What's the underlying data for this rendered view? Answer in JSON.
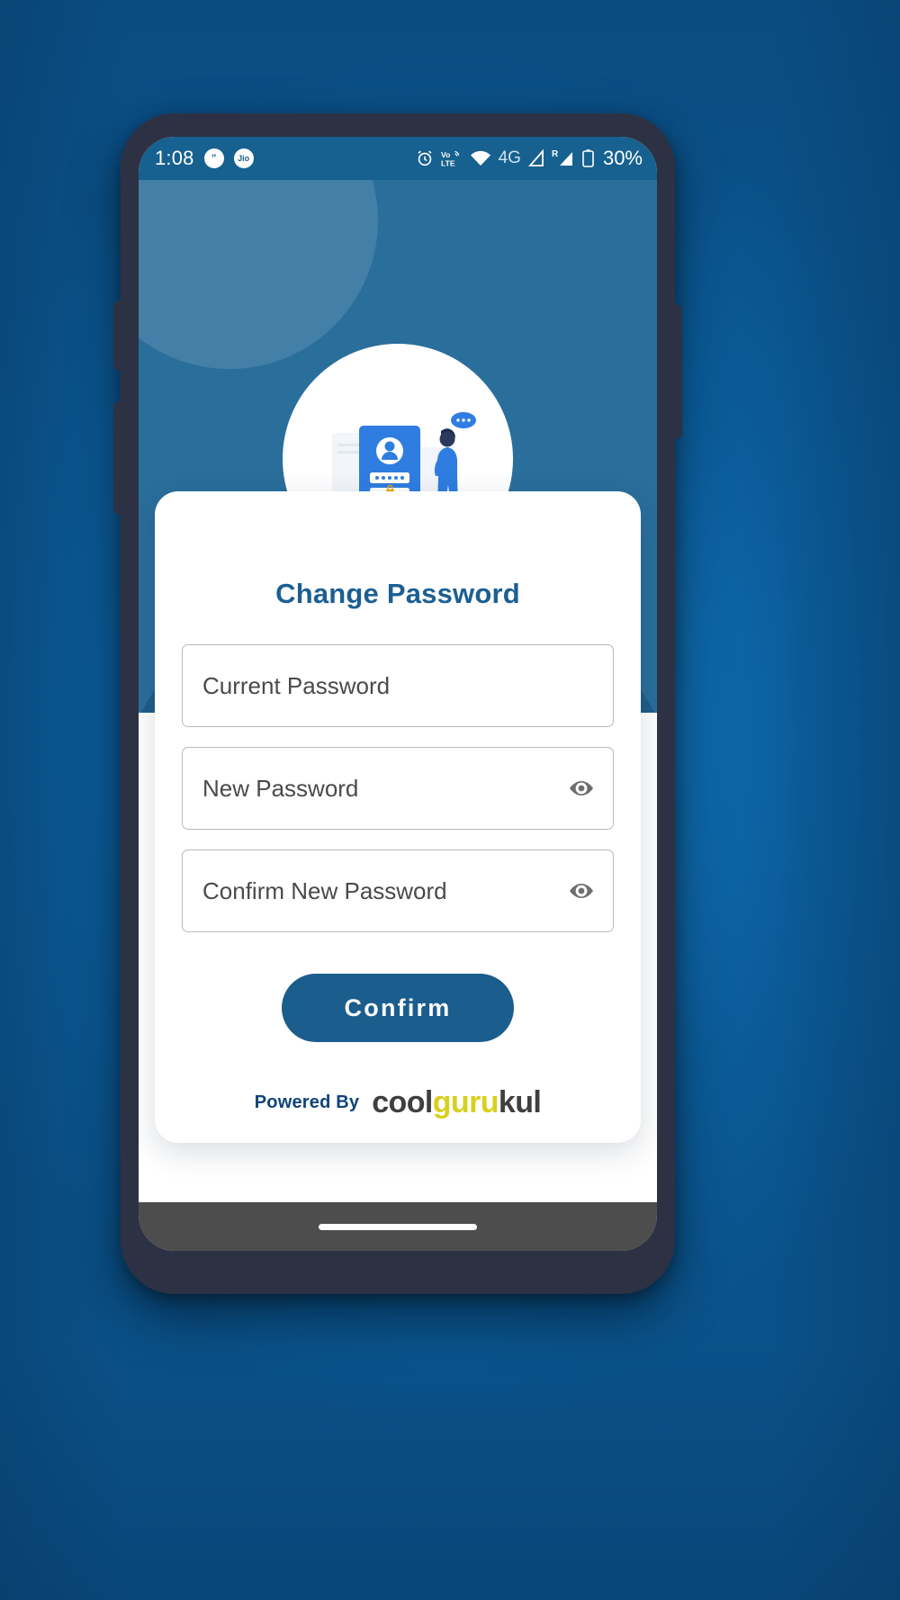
{
  "statusbar": {
    "time": "1:08",
    "left_icons": [
      {
        "name": "messaging-badge-icon",
        "glyph": "”"
      },
      {
        "name": "jio-badge-icon",
        "glyph": "Jio"
      }
    ],
    "right_icons": [
      {
        "name": "alarm-icon"
      },
      {
        "name": "volte-icon",
        "label": "Vo LTE"
      },
      {
        "name": "wifi-icon"
      },
      {
        "name": "network-4g-icon",
        "label": "4G"
      },
      {
        "name": "signal-bars-icon"
      },
      {
        "name": "roaming-signal-icon",
        "label": "R"
      },
      {
        "name": "battery-icon"
      }
    ],
    "battery_percent": "30%"
  },
  "illustration": {
    "name": "password-login-illustration",
    "alt": "person standing beside a phone showing an account avatar, masked password field and a lock"
  },
  "card": {
    "title": "Change Password",
    "fields": [
      {
        "name": "current-password",
        "placeholder": "Current Password",
        "value": "",
        "has_toggle": false
      },
      {
        "name": "new-password",
        "placeholder": "New Password",
        "value": "",
        "has_toggle": true
      },
      {
        "name": "confirm-new-password",
        "placeholder": "Confirm New Password",
        "value": "",
        "has_toggle": true
      }
    ],
    "submit_label": "Confirm",
    "footer": {
      "powered_by": "Powered By",
      "brand_part1": "cool",
      "brand_part2": "guru",
      "brand_part3": "kul"
    }
  },
  "colors": {
    "backdrop_blue": "#0f6cb0",
    "phone_frame": "#2c3243",
    "status_bar": "#16618f",
    "hero": "#2a6e9b",
    "hero_wave": "#1f5d88",
    "title_blue": "#1c5f92",
    "button_blue": "#1b5d8d",
    "brand_yellow": "#d9cf1f",
    "powered_by_blue": "#10447a",
    "field_border": "#b9b9b9",
    "nav_bar": "#4d4d4d"
  }
}
